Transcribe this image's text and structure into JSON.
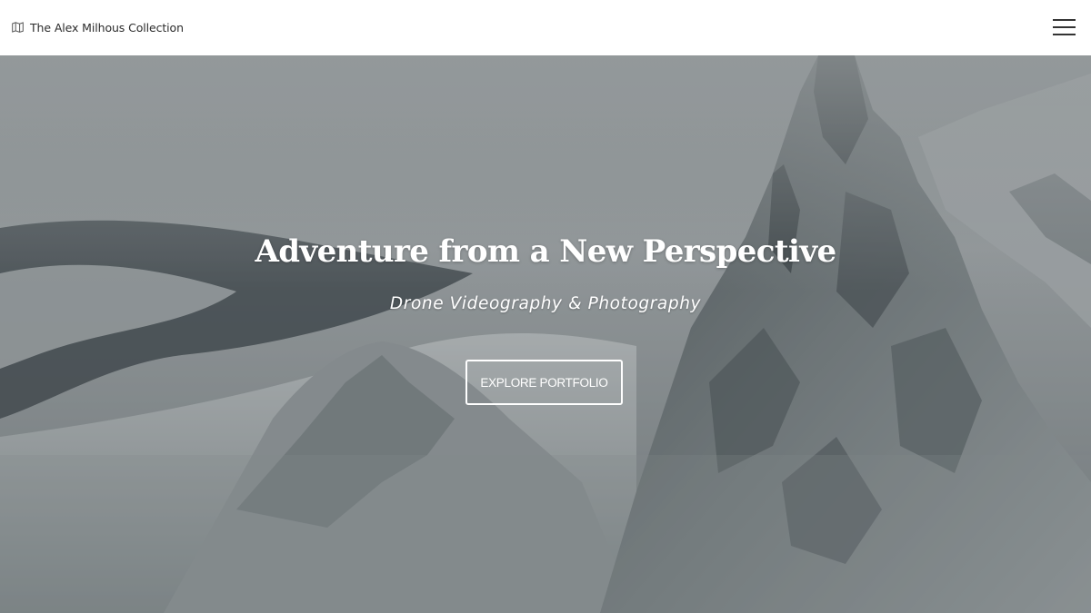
{
  "header": {
    "brand_text": "The Alex Milhous Collection",
    "brand_icon": "map-icon",
    "menu_icon": "hamburger-menu-icon"
  },
  "hero": {
    "title": "Adventure from a New Perspective",
    "subtitle": "Drone Videography & Photography",
    "button_label": "EXPLORE PORTFOLIO",
    "background": "snowy-mountain-peak-photo"
  },
  "colors": {
    "header_bg": "#ffffff",
    "brand_text": "#2b2b2b",
    "hero_text": "#ffffff",
    "hero_tint": "#6e7578"
  }
}
